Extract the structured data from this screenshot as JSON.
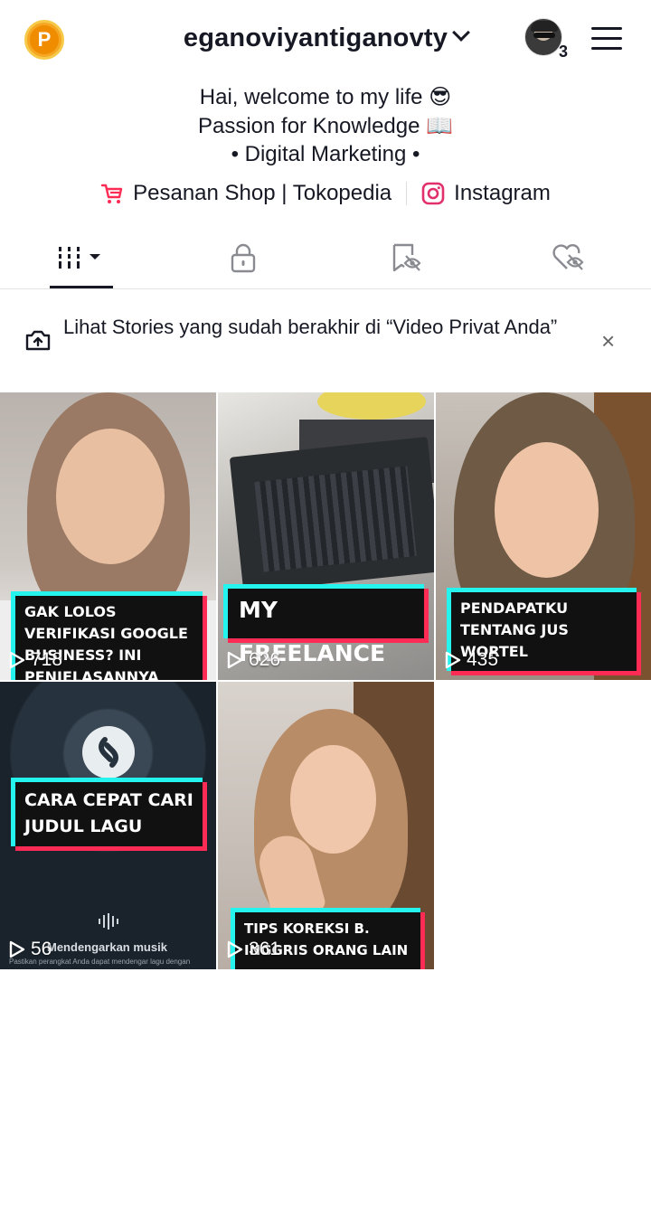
{
  "header": {
    "coin_letter": "P",
    "username": "eganoviyantiganovty",
    "avatar_badge_count": "3"
  },
  "bio": {
    "line1": "Hai, welcome to my life 😎",
    "line2": "Passion for Knowledge 📖",
    "line3": "• Digital Marketing •"
  },
  "links": {
    "shop_label": "Pesanan Shop | Tokopedia",
    "instagram_label": "Instagram"
  },
  "tabs": [
    {
      "name": "videos",
      "icon": "grid-bars-icon",
      "active": true
    },
    {
      "name": "private",
      "icon": "lock-icon",
      "active": false
    },
    {
      "name": "reposts-hidden",
      "icon": "bookmark-eye-off-icon",
      "active": false
    },
    {
      "name": "liked-hidden",
      "icon": "heart-eye-off-icon",
      "active": false
    }
  ],
  "banner": {
    "text": "Lihat Stories yang sudah berakhir di “Video Privat Anda”",
    "close_symbol": "×"
  },
  "videos": [
    {
      "caption": "GAK LOLOS VERIFIKASI GOOGLE BUSINESS? INI PENJELASANNYA",
      "views": "718"
    },
    {
      "caption": "MY FREELANCE",
      "views": "626"
    },
    {
      "caption": "PENDAPATKU TENTANG JUS WORTEL",
      "views": "435"
    },
    {
      "caption": "CARA CEPAT CARI JUDUL LAGU",
      "views": "56",
      "overlay_text": "Mendengarkan musik",
      "overlay_subtext": "Pastikan perangkat Anda dapat mendengar lagu dengan"
    },
    {
      "caption": "TIPS KOREKSI B. INGGRIS ORANG LAIN",
      "views": "361"
    }
  ],
  "colors": {
    "text_primary": "#161823",
    "tiktok_cyan": "#25f4ee",
    "tiktok_red": "#fe2c55",
    "coin_orange": "#f08c00",
    "instagram_pink": "#e1306c"
  }
}
